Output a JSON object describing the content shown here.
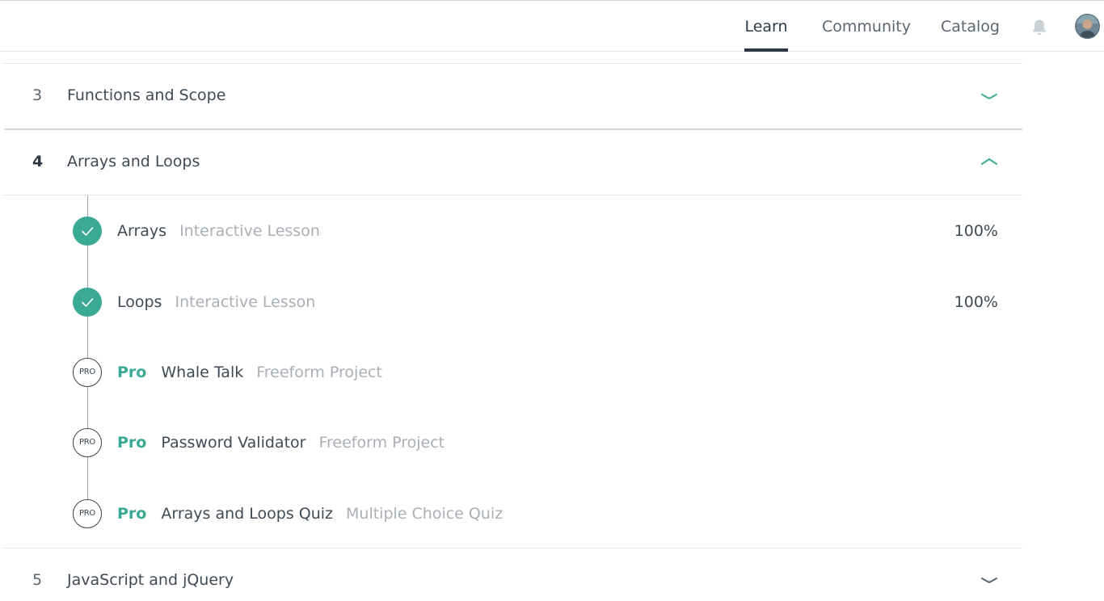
{
  "nav": {
    "learn": "Learn",
    "community": "Community",
    "catalog": "Catalog"
  },
  "icons": {
    "bell": "bell-icon",
    "avatar": "user-avatar",
    "chevron_down": "chevron-down-icon",
    "chevron_up": "chevron-up-icon",
    "check": "check-icon"
  },
  "colors": {
    "accent": "#3aaa94",
    "text": "#3f4a55",
    "muted": "#a9afb5"
  },
  "units": {
    "u3": {
      "number": "3",
      "title": "Functions and Scope",
      "expanded": false
    },
    "u4": {
      "number": "4",
      "title": "Arrays and Loops",
      "expanded": true
    },
    "u5": {
      "number": "5",
      "title": "JavaScript and jQuery",
      "expanded": false
    }
  },
  "lessons": [
    {
      "pro_label": "",
      "badge": "",
      "name": "Arrays",
      "type": "Interactive Lesson",
      "progress": "100%",
      "completed": true
    },
    {
      "pro_label": "",
      "badge": "",
      "name": "Loops",
      "type": "Interactive Lesson",
      "progress": "100%",
      "completed": true
    },
    {
      "pro_label": "Pro",
      "badge": "PRO",
      "name": "Whale Talk",
      "type": "Freeform Project",
      "progress": "",
      "completed": false
    },
    {
      "pro_label": "Pro",
      "badge": "PRO",
      "name": "Password Validator",
      "type": "Freeform Project",
      "progress": "",
      "completed": false
    },
    {
      "pro_label": "Pro",
      "badge": "PRO",
      "name": "Arrays and Loops Quiz",
      "type": "Multiple Choice Quiz",
      "progress": "",
      "completed": false
    }
  ]
}
